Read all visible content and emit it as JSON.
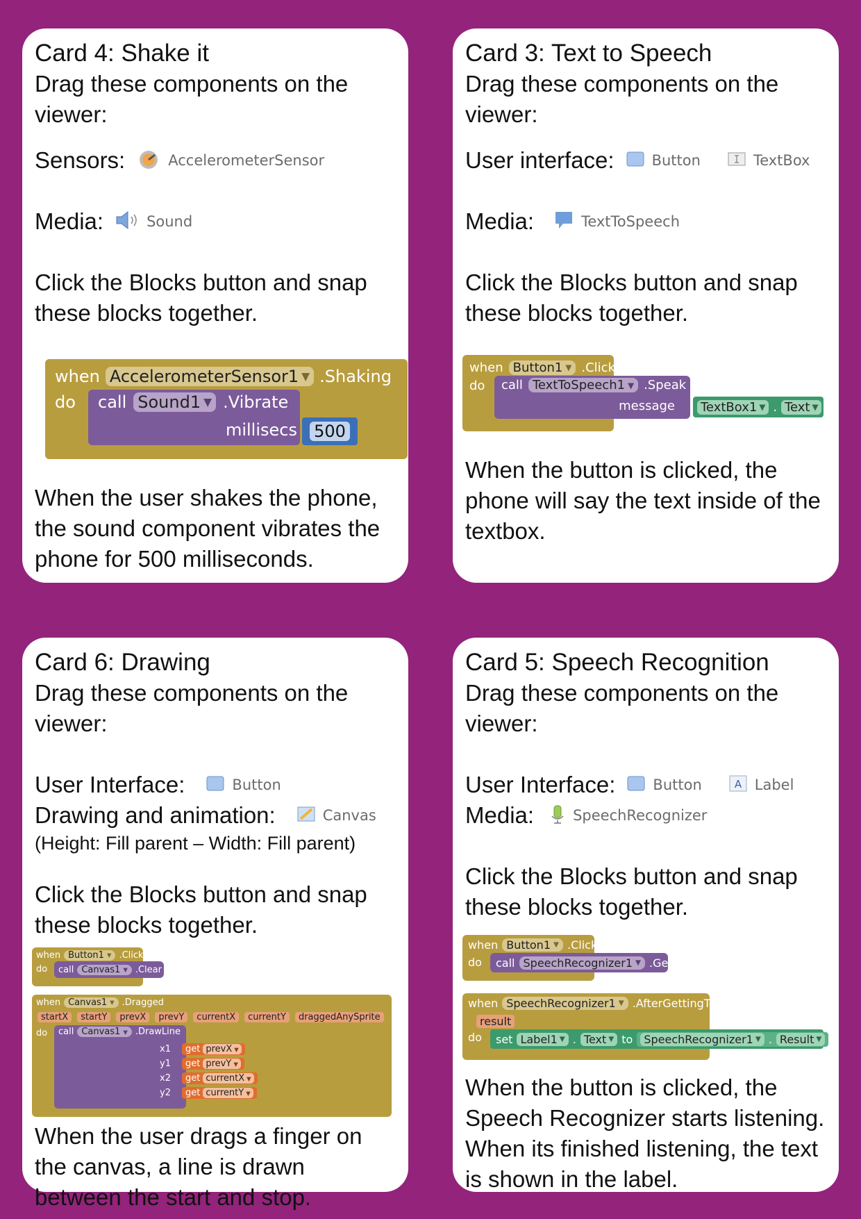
{
  "card4": {
    "title": "Card 4: Shake it",
    "subtitle": "Drag these components on the viewer:",
    "sensors_label": "Sensors:",
    "sensors_comp": "AccelerometerSensor",
    "media_label": "Media:",
    "media_comp": "Sound",
    "instruction": "Click the Blocks button and snap these blocks together.",
    "block": {
      "when": "when",
      "component": "AccelerometerSensor1",
      "event": ".Shaking",
      "do": "do",
      "call": "call",
      "target": "Sound1",
      "method": ".Vibrate",
      "param": "millisecs",
      "value": "500"
    },
    "description": "When the user shakes the phone, the sound component vibrates the phone for 500 milliseconds."
  },
  "card3": {
    "title": "Card 3: Text to Speech",
    "subtitle": "Drag these components on the viewer:",
    "ui_label": "User interface:",
    "ui_comp1": "Button",
    "ui_comp2": "TextBox",
    "media_label": "Media:",
    "media_comp": "TextToSpeech",
    "instruction": "Click the Blocks button and snap these blocks together.",
    "block": {
      "when": "when",
      "component": "Button1",
      "event": ".Click",
      "do": "do",
      "call": "call",
      "target": "TextToSpeech1",
      "method": ".Speak",
      "param": "message",
      "src": "TextBox1",
      "dot": ".",
      "prop": "Text"
    },
    "description": "When the button is clicked, the phone will say the text inside of the textbox."
  },
  "card6": {
    "title": "Card 6: Drawing",
    "subtitle": "Drag these components on the viewer:",
    "ui_label": "User Interface:",
    "ui_comp": "Button",
    "draw_label": "Drawing and animation:",
    "draw_comp": "Canvas",
    "size_note": "(Height: Fill parent – Width: Fill parent)",
    "instruction": "Click the Blocks button and snap these blocks together.",
    "block1": {
      "when": "when",
      "component": "Button1",
      "event": ".Click",
      "do": "do",
      "call": "call",
      "target": "Canvas1",
      "method": ".Clear"
    },
    "block2": {
      "when": "when",
      "component": "Canvas1",
      "event": ".Dragged",
      "params": [
        "startX",
        "startY",
        "prevX",
        "prevY",
        "currentX",
        "currentY",
        "draggedAnySprite"
      ],
      "do": "do",
      "call": "call",
      "target": "Canvas1",
      "method": ".DrawLine",
      "args": [
        {
          "name": "x1",
          "get": "get",
          "var": "prevX"
        },
        {
          "name": "y1",
          "get": "get",
          "var": "prevY"
        },
        {
          "name": "x2",
          "get": "get",
          "var": "currentX"
        },
        {
          "name": "y2",
          "get": "get",
          "var": "currentY"
        }
      ]
    },
    "description": "When the user drags a finger on the canvas, a line is drawn between the start and stop."
  },
  "card5": {
    "title": "Card 5: Speech Recognition",
    "subtitle": "Drag these components on the viewer:",
    "ui_label": "User Interface:",
    "ui_comp1": "Button",
    "ui_comp2": "Label",
    "media_label": "Media:",
    "media_comp": "SpeechRecognizer",
    "instruction": "Click the Blocks button and snap these blocks together.",
    "block1": {
      "when": "when",
      "component": "Button1",
      "event": ".Click",
      "do": "do",
      "call": "call",
      "target": "SpeechRecognizer1",
      "method": ".GetText"
    },
    "block2": {
      "when": "when",
      "component": "SpeechRecognizer1",
      "event": ".AfterGettingText",
      "param": "result",
      "do": "do",
      "set": "set",
      "target": "Label1",
      "dot": ".",
      "prop": "Text",
      "to": "to",
      "src": "SpeechRecognizer1",
      "src_dot": ".",
      "src_prop": "Result"
    },
    "description": "When the button is clicked, the Speech Recognizer starts listening. When its finished listening, the text is shown in the label."
  },
  "colors": {
    "background": "#93237b",
    "event_block": "#b89d3f",
    "procedure_block": "#7c5b9a",
    "number_block": "#3b70b8",
    "component_block": "#3c9a6c",
    "variable_block": "#e06d2e"
  },
  "icons": [
    "accelerometer-icon",
    "speaker-icon",
    "button-icon",
    "textbox-icon",
    "speech-bubble-icon",
    "canvas-icon",
    "label-icon",
    "microphone-icon"
  ]
}
